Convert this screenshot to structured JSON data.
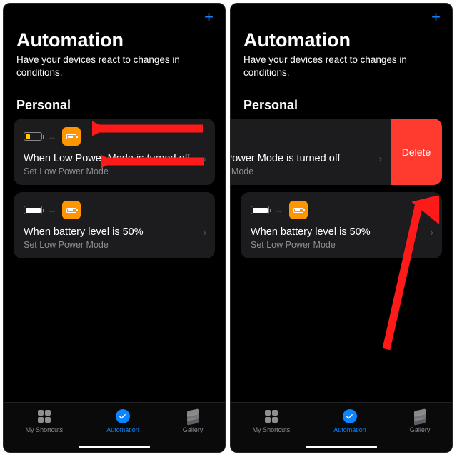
{
  "header": {
    "title": "Automation",
    "subtitle": "Have your devices react to changes in conditions."
  },
  "section_label": "Personal",
  "cards": [
    {
      "title": "When Low Power Mode is turned off",
      "sub": "Set Low Power Mode"
    },
    {
      "title": "When battery level is 50%",
      "sub": "Set Low Power Mode"
    }
  ],
  "shifted_card_title": "Low Power Mode is turned off",
  "shifted_card_sub": "Power Mode",
  "delete_label": "Delete",
  "tabs": {
    "shortcuts": "My Shortcuts",
    "automation": "Automation",
    "gallery": "Gallery"
  },
  "colors": {
    "accent": "#0a84ff",
    "warn": "#ff3b30",
    "orange": "#ff9500"
  }
}
